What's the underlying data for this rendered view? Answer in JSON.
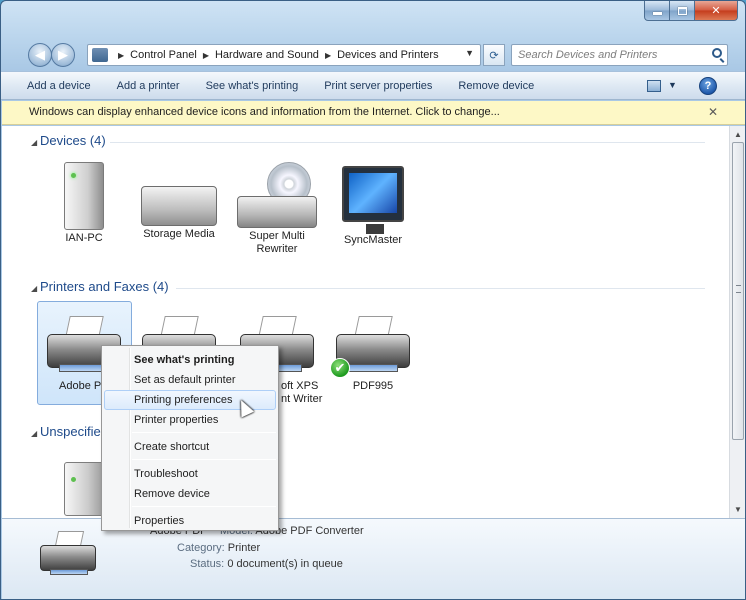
{
  "window": {
    "caption": {
      "minimize": "",
      "maximize": "",
      "close": "✕"
    }
  },
  "nav": {
    "back": "◀",
    "forward": "▶",
    "breadcrumb": [
      "Control Panel",
      "Hardware and Sound",
      "Devices and Printers"
    ],
    "crumb_sep": "▶",
    "dropdown": "▼",
    "refresh": "⟳",
    "search_placeholder": "Search Devices and Printers"
  },
  "toolbar": {
    "commands": [
      "Add a device",
      "Add a printer",
      "See what's printing",
      "Print server properties",
      "Remove device"
    ],
    "view_dropdown": "▼",
    "help": "?"
  },
  "infobar": {
    "text": "Windows can display enhanced device icons and information from the Internet. Click to change...",
    "close": "✕"
  },
  "groups": {
    "devices": {
      "title": "Devices (4)",
      "toggle": "◢"
    },
    "printers": {
      "title": "Printers and Faxes (4)",
      "toggle": "◢"
    },
    "unspecified": {
      "title": "Unspecifie",
      "toggle": "◢"
    }
  },
  "devices": [
    {
      "label": "IAN-PC",
      "icon": "computer-icon"
    },
    {
      "label": "Storage Media",
      "icon": "storage-drive-icon"
    },
    {
      "label": "Super Multi Rewriter",
      "icon": "optical-drive-icon"
    },
    {
      "label": "SyncMaster",
      "icon": "monitor-icon"
    }
  ],
  "printers": [
    {
      "label": "Adobe PD",
      "icon": "printer-icon",
      "selected": true
    },
    {
      "label": "",
      "icon": "printer-icon"
    },
    {
      "label": "oft XPS",
      "label2": "nt Writer",
      "icon": "printer-icon"
    },
    {
      "label": "PDF995",
      "icon": "printer-icon",
      "default": true,
      "badge": "✔"
    }
  ],
  "context_menu": {
    "items": [
      {
        "label": "See what's printing",
        "bold": true
      },
      {
        "label": "Set as default printer"
      },
      {
        "label": "Printing preferences",
        "hover": true
      },
      {
        "label": "Printer properties"
      },
      {
        "label": "Create shortcut"
      },
      {
        "label": "Troubleshoot"
      },
      {
        "label": "Remove device"
      },
      {
        "label": "Properties"
      }
    ]
  },
  "details": {
    "name": "Adobe PDF",
    "model_key": "Model:",
    "model_val": "Adobe PDF Converter",
    "category_key": "Category:",
    "category_val": "Printer",
    "status_key": "Status:",
    "status_val": "0 document(s) in queue"
  },
  "scrollbar": {
    "up": "▲",
    "down": "▼"
  },
  "colors": {
    "accent": "#1e4a8a",
    "infobar_bg": "#fdf8c6",
    "selection": "#cfe5fa",
    "close_red": "#c43c1c"
  }
}
